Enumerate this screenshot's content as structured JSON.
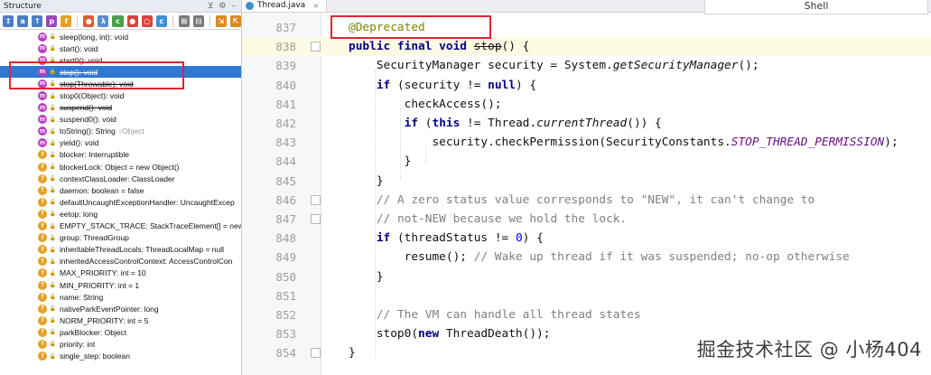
{
  "structure": {
    "title": "Structure",
    "header_icons": [
      "⊻",
      "⚙",
      "–"
    ],
    "toolbar_icons": [
      {
        "name": "sort-visibility-icon",
        "glyph": "↕",
        "color": "#4a7fc1"
      },
      {
        "name": "sort-alpha-icon",
        "glyph": "a",
        "color": "#4a7fc1"
      },
      {
        "name": "show-inherited-icon",
        "glyph": "↑",
        "color": "#4a7fc1"
      },
      {
        "name": "show-properties-icon",
        "glyph": "p",
        "color": "#9a48b8"
      },
      {
        "name": "show-fields-icon",
        "glyph": "f",
        "color": "#e5a126"
      },
      {
        "name": "show-nonpublic-icon",
        "glyph": "●",
        "color": "#e05a38"
      },
      {
        "name": "show-lambdas-icon",
        "glyph": "λ",
        "color": "#5b8dd1"
      },
      {
        "name": "show-anonymous-icon",
        "glyph": "c",
        "color": "#4aa04a"
      },
      {
        "name": "show-constants-icon",
        "glyph": "●",
        "color": "#d8443a"
      },
      {
        "name": "show-enums-icon",
        "glyph": "○",
        "color": "#d8443a"
      },
      {
        "name": "show-classes-icon",
        "glyph": "c",
        "color": "#3f8fd4"
      },
      {
        "name": "expand-all-icon",
        "glyph": "⊞",
        "color": "#7a7a7a"
      },
      {
        "name": "collapse-all-icon",
        "glyph": "⊟",
        "color": "#7a7a7a"
      },
      {
        "name": "autoscroll-to-source-icon",
        "glyph": "⇲",
        "color": "#d98b23"
      },
      {
        "name": "autoscroll-from-source-icon",
        "glyph": "⇱",
        "color": "#d98b23"
      }
    ],
    "items": [
      {
        "kind": "m",
        "text": "sleep(long, int): void",
        "strike": false,
        "extra": ""
      },
      {
        "kind": "m",
        "text": "start(): void",
        "strike": false,
        "extra": ""
      },
      {
        "kind": "m",
        "text": "start0(): void",
        "strike": false,
        "extra": ""
      },
      {
        "kind": "m",
        "text": "stop(): void",
        "strike": true,
        "extra": "",
        "selected": true
      },
      {
        "kind": "m",
        "text": "stop(Throwable): void",
        "strike": true,
        "extra": ""
      },
      {
        "kind": "m",
        "text": "stop0(Object): void",
        "strike": false,
        "extra": ""
      },
      {
        "kind": "m",
        "text": "suspend(): void",
        "strike": true,
        "extra": ""
      },
      {
        "kind": "m",
        "text": "suspend0(): void",
        "strike": false,
        "extra": ""
      },
      {
        "kind": "m",
        "text": "toString(): String",
        "strike": false,
        "extra": "↑Object"
      },
      {
        "kind": "m",
        "text": "yield(): void",
        "strike": false,
        "extra": ""
      },
      {
        "kind": "f",
        "text": "blocker: Interruptible",
        "strike": false,
        "extra": ""
      },
      {
        "kind": "f",
        "text": "blockerLock: Object = new Object()",
        "strike": false,
        "extra": ""
      },
      {
        "kind": "f",
        "text": "contextClassLoader: ClassLoader",
        "strike": false,
        "extra": ""
      },
      {
        "kind": "f",
        "text": "daemon: boolean = false",
        "strike": false,
        "extra": ""
      },
      {
        "kind": "f",
        "text": "defaultUncaughtExceptionHandler: UncaughtExcep",
        "strike": false,
        "extra": ""
      },
      {
        "kind": "f",
        "text": "eetop: long",
        "strike": false,
        "extra": ""
      },
      {
        "kind": "f",
        "text": "EMPTY_STACK_TRACE: StackTraceElement[] = new",
        "strike": false,
        "extra": ""
      },
      {
        "kind": "f",
        "text": "group: ThreadGroup",
        "strike": false,
        "extra": ""
      },
      {
        "kind": "f",
        "text": "inheritableThreadLocals: ThreadLocalMap = null",
        "strike": false,
        "extra": ""
      },
      {
        "kind": "f",
        "text": "inheritedAccessControlContext: AccessControlCon",
        "strike": false,
        "extra": ""
      },
      {
        "kind": "f",
        "text": "MAX_PRIORITY: int = 10",
        "strike": false,
        "extra": ""
      },
      {
        "kind": "f",
        "text": "MIN_PRIORITY: int = 1",
        "strike": false,
        "extra": ""
      },
      {
        "kind": "f",
        "text": "name: String",
        "strike": false,
        "extra": ""
      },
      {
        "kind": "f",
        "text": "nativeParkEventPointer: long",
        "strike": false,
        "extra": ""
      },
      {
        "kind": "f",
        "text": "NORM_PRIORITY: int = 5",
        "strike": false,
        "extra": ""
      },
      {
        "kind": "f",
        "text": "parkBlocker: Object",
        "strike": false,
        "extra": ""
      },
      {
        "kind": "f",
        "text": "priority: int",
        "strike": false,
        "extra": ""
      },
      {
        "kind": "f",
        "text": "single_step: boolean",
        "strike": false,
        "extra": ""
      }
    ]
  },
  "editor": {
    "tab_label": "Thread.java",
    "tab_close": "×",
    "popup_text": "Shell",
    "lines": [
      {
        "num": "837",
        "html": "<span class=\"ann\">@Deprecated</span>"
      },
      {
        "num": "838",
        "html": "<span class=\"kw\">public final void</span> <span class=\"stop\">stop</span>() {",
        "hl": true,
        "fold": true
      },
      {
        "num": "839",
        "html": "    SecurityManager security = System.<span class=\"it\">getSecurityManager</span>();"
      },
      {
        "num": "840",
        "html": "    <span class=\"kw\">if</span> (security != <span class=\"kw\">null</span>) {"
      },
      {
        "num": "841",
        "html": "        checkAccess();"
      },
      {
        "num": "842",
        "html": "        <span class=\"kw\">if</span> (<span class=\"kw\">this</span> != Thread.<span class=\"it\">currentThread</span>()) {"
      },
      {
        "num": "843",
        "html": "            security.checkPermission(SecurityConstants.<span class=\"cst\">STOP_THREAD_PERMISSION</span>);"
      },
      {
        "num": "844",
        "html": "        }"
      },
      {
        "num": "845",
        "html": "    }"
      },
      {
        "num": "846",
        "html": "    <span class=\"cm\">// A zero status value corresponds to \"NEW\", it can't change to</span>",
        "fold": true
      },
      {
        "num": "847",
        "html": "    <span class=\"cm\">// not-NEW because we hold the lock.</span>",
        "fold": true
      },
      {
        "num": "848",
        "html": "    <span class=\"kw\">if</span> (threadStatus != <span class=\"num\">0</span>) {"
      },
      {
        "num": "849",
        "html": "        resume(); <span class=\"cm\">// Wake up thread if it was suspended; no-op otherwise</span>"
      },
      {
        "num": "850",
        "html": "    }"
      },
      {
        "num": "851",
        "html": ""
      },
      {
        "num": "852",
        "html": "    <span class=\"cm\">// The VM can handle all thread states</span>"
      },
      {
        "num": "853",
        "html": "    stop0(<span class=\"kw\">new</span> ThreadDeath());"
      },
      {
        "num": "854",
        "html": "}",
        "fold": true
      }
    ]
  },
  "watermark": "掘金技术社区 @ 小杨404",
  "colors": {
    "selection": "#2f78d3",
    "highlight_box": "#e0262f",
    "method_badge": "#b83dbf",
    "field_badge": "#e5a126",
    "keyword": "#000080",
    "annotation": "#808000",
    "comment": "#808080",
    "constant": "#660e7a"
  }
}
